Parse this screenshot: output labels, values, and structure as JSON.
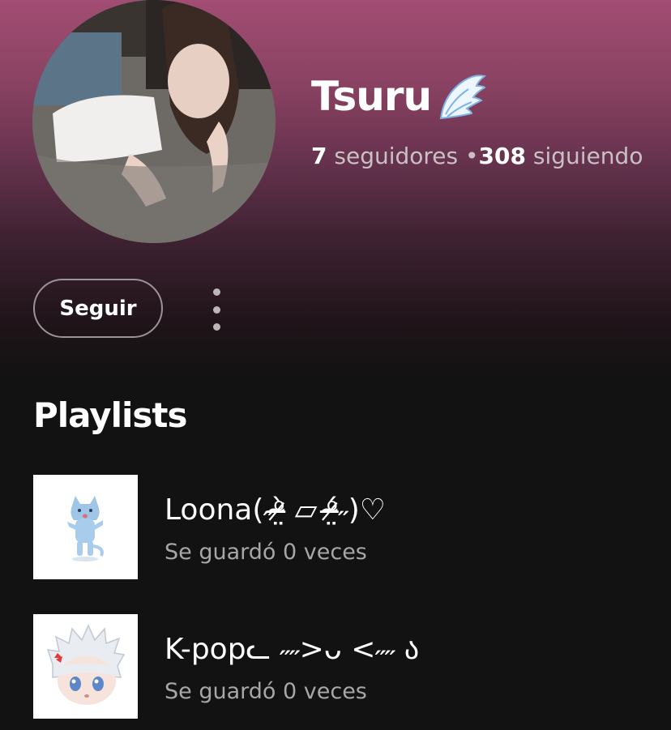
{
  "profile": {
    "name": "Tsuru",
    "name_icon": "angel-wing-icon",
    "followers_count": "7",
    "followers_label": "seguidores",
    "separator": "•",
    "following_count": "308",
    "following_label": "siguiendo",
    "avatar": "profile-photo"
  },
  "actions": {
    "follow_label": "Seguir",
    "more_icon": "more-vertical-icon"
  },
  "playlists": {
    "title": "Playlists",
    "items": [
      {
        "title": "Loona(˶ᵒ̴̶̷̤̀ ▱ ᵒ̴̶̷̤́˶)♡",
        "subtitle": "Se guardó 0 veces",
        "cover": "blue-cat-cover"
      },
      {
        "title": "K-popᓚ ˶˶>ᴗ <˶˶ ა",
        "subtitle": "Se guardó 0 veces",
        "cover": "anime-character-cover"
      }
    ]
  },
  "colors": {
    "header_gradient_top": "#a24d73",
    "background": "#121212",
    "subtext": "#a7a7a7",
    "stats_text": "#c9c0c4"
  }
}
